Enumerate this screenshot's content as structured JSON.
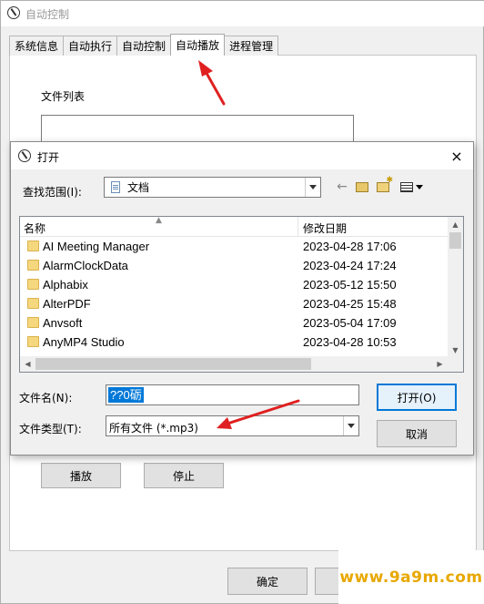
{
  "main_window": {
    "title": "自动控制",
    "tabs": [
      {
        "label": "系统信息"
      },
      {
        "label": "自动执行"
      },
      {
        "label": "自动控制"
      },
      {
        "label": "自动播放"
      },
      {
        "label": "进程管理"
      }
    ],
    "active_tab_index": 3,
    "file_list_label": "文件列表",
    "play_button": "播放",
    "stop_button": "停止",
    "ok_button": "确定"
  },
  "open_dialog": {
    "title": "打开",
    "close_icon": "×",
    "look_in_label": "查找范围(I):",
    "look_in_value": "文档",
    "columns": {
      "name": "名称",
      "date_modified": "修改日期"
    },
    "files": [
      {
        "name": "AI Meeting Manager",
        "date": "2023-04-28 17:06"
      },
      {
        "name": "AlarmClockData",
        "date": "2023-04-24 17:24"
      },
      {
        "name": "Alphabix",
        "date": "2023-05-12 15:50"
      },
      {
        "name": "AlterPDF",
        "date": "2023-04-25 15:48"
      },
      {
        "name": "Anvsoft",
        "date": "2023-05-04 17:09"
      },
      {
        "name": "AnyMP4 Studio",
        "date": "2023-04-28 10:53"
      }
    ],
    "file_name_label": "文件名(N):",
    "file_name_value": "??0砺",
    "file_type_label": "文件类型(T):",
    "file_type_value": "所有文件 (*.mp3)",
    "open_button": "打开(O)",
    "cancel_button": "取消"
  },
  "watermark": "www.9a9m.com",
  "colors": {
    "arrow": "#e02020",
    "selection": "#0078d7",
    "watermark": "#e8a800"
  }
}
